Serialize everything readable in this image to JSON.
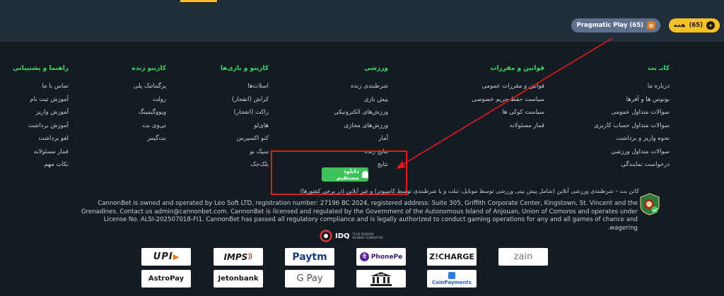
{
  "filters": {
    "all": {
      "label": "همه",
      "count": "(65)"
    },
    "pragmatic": {
      "label": "Pragmatic Play (65)"
    }
  },
  "footer": {
    "columns": [
      {
        "title": "کانـ بت",
        "items": [
          "درباره ما",
          "بونوس ها و آفرها",
          "سوالات متداول عمومی",
          "سوالات متداول حساب کاربری",
          "نحوه واریز و برداشت",
          "سوالات متداول ورزشی",
          "درخواست نمایندگی"
        ]
      },
      {
        "title": "قوانین و مقررات",
        "items": [
          "قوانین و مقررات عمومی",
          "سیاست حفظ حریم خصوصی",
          "سیاست کوکی ها",
          "قمار مسئولانه"
        ]
      },
      {
        "title": "ورزشی",
        "items": [
          "شرطبندی زنده",
          "پیش بازی",
          "ورزش‌های الکترونیکی",
          "ورزش‌های مجازی",
          "آمار",
          "نتایج زنده",
          "نتایج"
        ]
      },
      {
        "title": "کازینو و بازی‌ها",
        "items": [
          "اسلات‌ها",
          "کراش (انفجار)",
          "راکت (انفجار)",
          "های‌لو",
          "کنو اکسپرس",
          "سیک بو",
          "بلک‌جک"
        ]
      },
      {
        "title": "کازینو زنده",
        "items": [
          "پرگماتیک پلی",
          "رولت",
          "ویووگیمینگ",
          "تی‌وی بت",
          "بت‌گیمز"
        ]
      },
      {
        "title": "راهنما و پشتیبانی",
        "items": [
          "تماس با ما",
          "آموزش ثبت نام",
          "آموزش واریز",
          "آموزش برداشت",
          "لغو برداشت",
          "قمار مسئولانه",
          "نکات مهم"
        ]
      }
    ],
    "download": "دانلود مستقیم",
    "tagline": "کانن بت – شرطبندی ورزشی آنلاین (شامل پیش بینی ورزشی توسط موبایل، تبلت و یا شرطبندی توسط کامپیوتر) و غیر آنلاین (در برخی کشورها)",
    "legal": "CannonBet is owned and operated by Leo Soft LTD, registration number: 27196 BC 2024, registered address: Suite 305, Griffith Corporate Center, Kingstown, St. Vincent and the Grenadines. Contact us admin@cannonbet.com. CannonBet is licensed and regulated by the Government of the Autonomous Island of Anjouan, Union of Comoros and operates under License No. ALSI-202507018-FI1. CannonBet has passed all regulatory compliance and is legally authorized to conduct gaming operations for any and all games of chance and wagering.",
    "idq": {
      "mark": "IDQ",
      "sub1": "TRUE RANDOM",
      "sub2": "NUMBER GENERATOR"
    },
    "payments": {
      "upi": "UPI",
      "imps": "IMPS",
      "paytm": "Paytm",
      "phonepe": "PhonePe",
      "zcharge": "Z!CHARGE",
      "zain": "zain",
      "astropay": "AstroPay",
      "jetonbank": "Jetonbank",
      "gpay": "G Pay",
      "bank": "BANK",
      "coinpayments": "CoinPayments"
    }
  },
  "colors": {
    "accent": "#f5c02e",
    "heading": "#3ddc6a",
    "download": "#3cc35a",
    "annotation": "#e21c1c"
  }
}
